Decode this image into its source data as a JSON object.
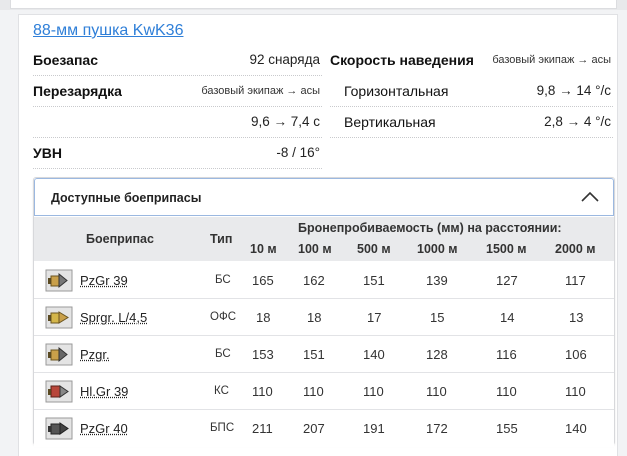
{
  "gun": {
    "title": "88-мм пушка KwK36"
  },
  "stats": {
    "ammo_label": "Боезапас",
    "ammo_value": "92 снаряда",
    "reload_label": "Перезарядка",
    "reload_note": "базовый экипаж → асы",
    "reload_value": "9,6 → 7,4 с",
    "elevation_label": "УВН",
    "elevation_value": "-8 / 16°",
    "traverse_label": "Скорость наведения",
    "traverse_note": "базовый экипаж → асы",
    "horizontal_label": "Горизонтальная",
    "horizontal_value": "9,8 → 14 °/с",
    "vertical_label": "Вертикальная",
    "vertical_value": "2,8 → 4 °/с"
  },
  "ammo": {
    "header": "Доступные боеприпасы",
    "col_shell": "Боеприпас",
    "col_type": "Тип",
    "col_penetration": "Бронепробиваемость (мм) на расстоянии:",
    "distances": [
      "10 м",
      "100 м",
      "500 м",
      "1000 м",
      "1500 м",
      "2000 м"
    ],
    "rows": [
      {
        "name": "PzGr 39",
        "type": "БС",
        "values": [
          "165",
          "162",
          "151",
          "139",
          "127",
          "117"
        ],
        "icon": "apcbc-shell-icon"
      },
      {
        "name": "Sprgr. L/4,5",
        "type": "ОФС",
        "values": [
          "18",
          "18",
          "17",
          "15",
          "14",
          "13"
        ],
        "icon": "he-shell-icon"
      },
      {
        "name": "Pzgr.",
        "type": "БС",
        "values": [
          "153",
          "151",
          "140",
          "128",
          "116",
          "106"
        ],
        "icon": "ap-shell-icon"
      },
      {
        "name": "Hl.Gr 39",
        "type": "КС",
        "values": [
          "110",
          "110",
          "110",
          "110",
          "110",
          "110"
        ],
        "icon": "heat-shell-icon"
      },
      {
        "name": "PzGr 40",
        "type": "БПС",
        "values": [
          "211",
          "207",
          "191",
          "172",
          "155",
          "140"
        ],
        "icon": "apcr-shell-icon"
      }
    ]
  },
  "colors": {
    "link": "#2f7fd8",
    "header_border": "#9bb8e0",
    "table_header": "#e9eaec"
  }
}
